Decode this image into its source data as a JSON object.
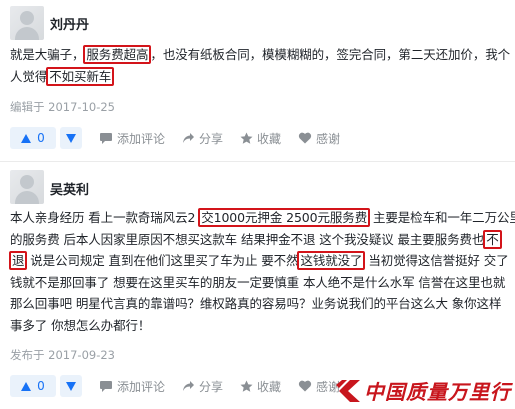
{
  "comments": [
    {
      "username": "刘丹丹",
      "lines": [
        [
          {
            "t": "就是大骗子，"
          },
          {
            "t": "服务费超高",
            "hl": true
          },
          {
            "t": "，也没有纸板合同，模模糊糊的，签完合同，第二天还加价，我个"
          }
        ],
        [
          {
            "t": "人觉得"
          },
          {
            "t": "不如买新车",
            "hl": true
          }
        ]
      ],
      "date": "编辑于 2017-10-25",
      "upvotes": "0"
    },
    {
      "username": "吴英利",
      "lines": [
        [
          {
            "t": "本人亲身经历 看上一款奇瑞风云2 "
          },
          {
            "t": "交1000元押金 2500元服务费",
            "hl": true
          },
          {
            "t": " 主要是检车和一年二万公里"
          }
        ],
        [
          {
            "t": "的服务费 后本人因家里原因不想买这款车 结果押金不退  这个我没疑议  最主要服务费也"
          },
          {
            "t": "不",
            "hl": true
          }
        ],
        [
          {
            "t": "退",
            "hl": true
          },
          {
            "t": " 说是公司规定  直到在他们这里买了车为止  要不然"
          },
          {
            "t": "这钱就没了",
            "hl": true
          },
          {
            "t": " 当初觉得这信誉挺好  交了"
          }
        ],
        [
          {
            "t": "钱就不是那回事了 想要在这里买车的朋友一定要慎重  本人绝不是什么水军 信誉在这里也就"
          }
        ],
        [
          {
            "t": "那么回事吧  明星代言真的靠谱吗？维权路真的容易吗？业务说我们的平台这么大 象你这样"
          }
        ],
        [
          {
            "t": "事多了 你想怎么办都行！"
          }
        ]
      ],
      "date": "发布于 2017-09-23",
      "upvotes": "0"
    }
  ],
  "actions": {
    "comment": "添加评论",
    "share": "分享",
    "favorite": "收藏",
    "thanks": "感谢"
  },
  "watermark": {
    "text": "中国质量万里行",
    "color": "#c8161d"
  },
  "icons": [
    "thumbs-up-icon",
    "thumbs-down-icon",
    "comment-icon",
    "share-icon",
    "star-icon",
    "heart-icon",
    "avatar"
  ]
}
